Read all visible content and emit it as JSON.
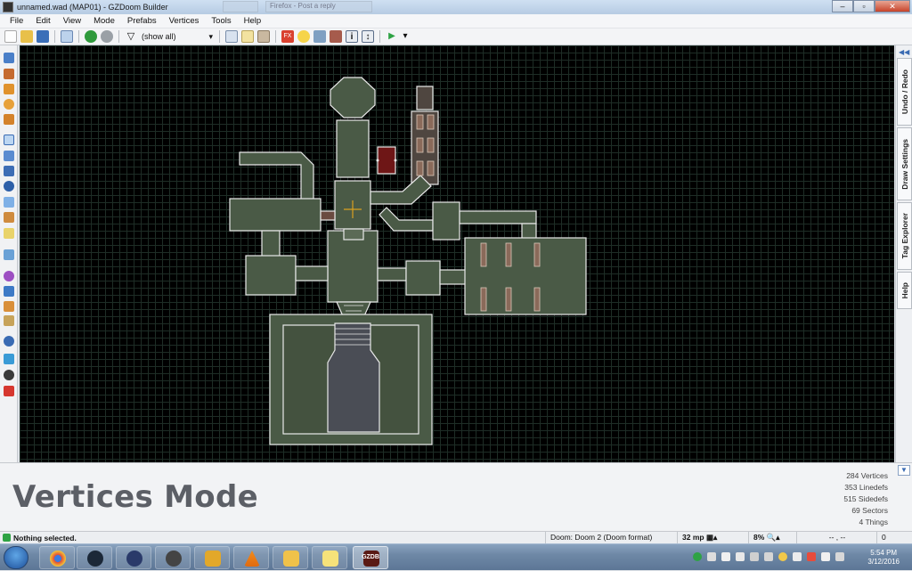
{
  "window": {
    "title": "unnamed.wad (MAP01) - GZDoom Builder",
    "ghost_tabs": [
      "",
      "Firefox - Post a reply"
    ]
  },
  "menu": [
    "File",
    "Edit",
    "View",
    "Mode",
    "Prefabs",
    "Vertices",
    "Tools",
    "Help"
  ],
  "toolbar": {
    "filter_label": "(show all)"
  },
  "dock_tabs": [
    "Undo / Redo",
    "Draw Settings",
    "Tag Explorer",
    "Help"
  ],
  "info": {
    "mode_name": "Vertices Mode",
    "stats": [
      {
        "count": "284",
        "label": "Vertices"
      },
      {
        "count": "353",
        "label": "Linedefs"
      },
      {
        "count": "515",
        "label": "Sidedefs"
      },
      {
        "count": "69",
        "label": "Sectors"
      },
      {
        "count": "4",
        "label": "Things"
      }
    ]
  },
  "status": {
    "message": "Nothing selected.",
    "game": "Doom: Doom 2 (Doom format)",
    "grid": "32 mp",
    "zoom": "8%",
    "coords": "-- , --",
    "count": "0"
  },
  "taskbar": {
    "items": [
      "chrome",
      "steam",
      "sketch",
      "daemon",
      "stopwatch",
      "vlc",
      "explorer",
      "notes",
      "gzdb"
    ],
    "active_label": "GZDB",
    "time": "5:54 PM",
    "date": "3/12/2016"
  },
  "colors": {
    "sector_fill": "#4a5a46",
    "linedef": "#e8e8e8",
    "background": "#000000",
    "mode_text": "#5c5f66"
  }
}
